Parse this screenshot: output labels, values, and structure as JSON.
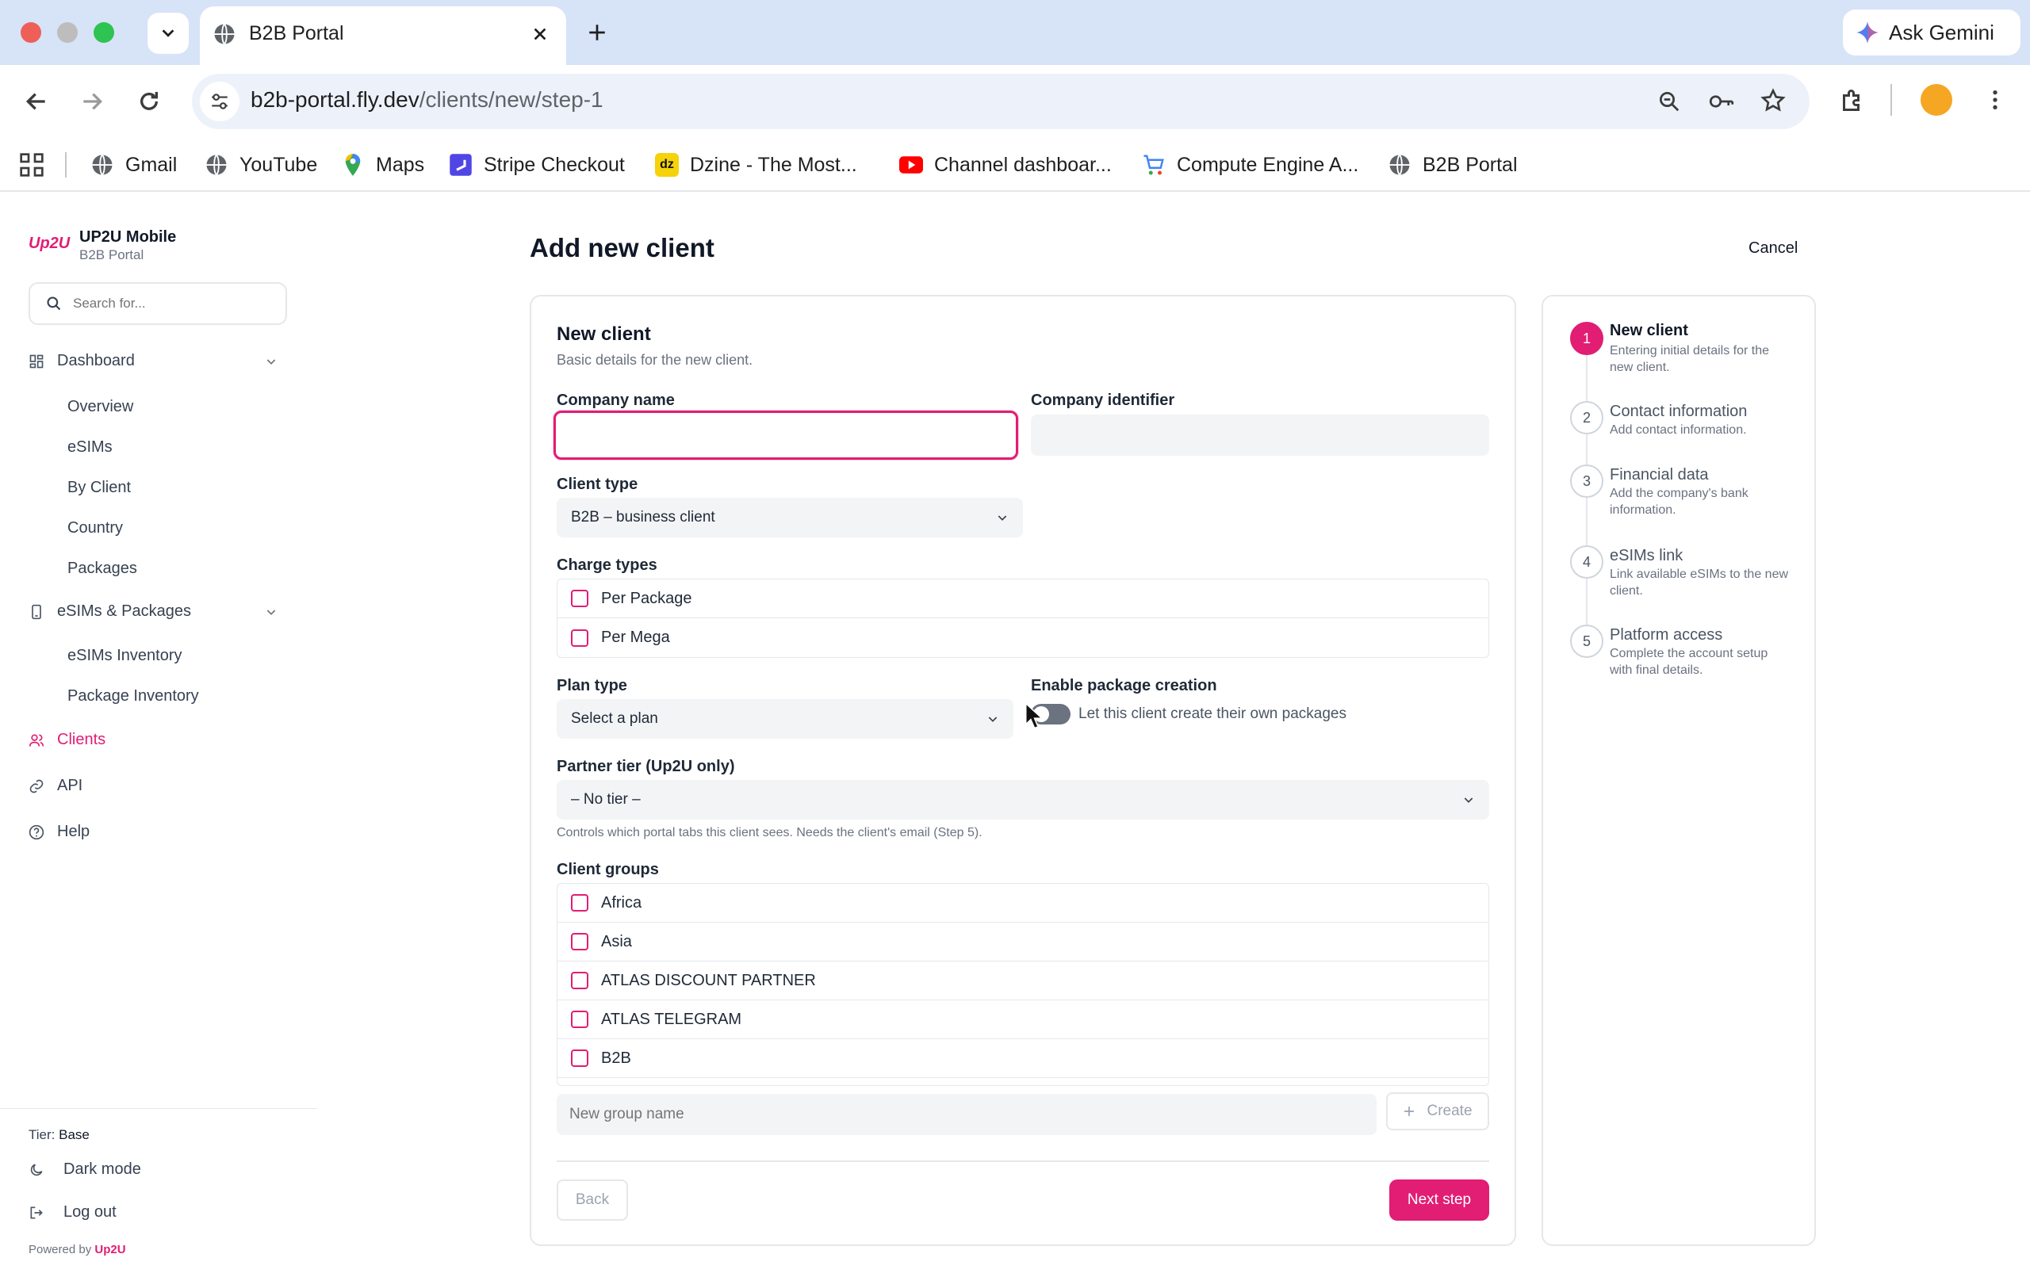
{
  "browser": {
    "tab_title": "B2B Portal",
    "url_host": "b2b-portal.fly.dev",
    "url_path": "/clients/new/step-1",
    "ask_gemini": "Ask Gemini",
    "bookmarks": [
      "Gmail",
      "YouTube",
      "Maps",
      "Stripe Checkout",
      "Dzine - The Most...",
      "Channel dashboar...",
      "Compute Engine A...",
      "B2B Portal"
    ],
    "dz_logo": "dz"
  },
  "brand": {
    "logo_text": "Up2U",
    "name": "UP2U Mobile",
    "subtitle": "B2B Portal"
  },
  "search": {
    "placeholder": "Search for..."
  },
  "nav": {
    "dashboard": "Dashboard",
    "dashboard_items": [
      "Overview",
      "eSIMs",
      "By Client",
      "Country",
      "Packages"
    ],
    "esims_packages": "eSIMs & Packages",
    "esims_items": [
      "eSIMs Inventory",
      "Package Inventory"
    ],
    "clients": "Clients",
    "api": "API",
    "help": "Help"
  },
  "footer": {
    "tier_label": "Tier:",
    "tier_value": "Base",
    "dark_mode": "Dark mode",
    "log_out": "Log out",
    "powered_by": "Powered by",
    "powered_brand": "Up2U"
  },
  "page": {
    "title": "Add new client",
    "cancel": "Cancel"
  },
  "form": {
    "section_title": "New client",
    "section_desc": "Basic details for the new client.",
    "company_name_label": "Company name",
    "company_identifier_label": "Company identifier",
    "client_type_label": "Client type",
    "client_type_value": "B2B – business client",
    "charge_types_label": "Charge types",
    "charge_types": [
      "Per Package",
      "Per Mega"
    ],
    "plan_type_label": "Plan type",
    "plan_type_value": "Select a plan",
    "enable_pkg_label": "Enable package creation",
    "enable_pkg_desc": "Let this client create their own packages",
    "partner_tier_label": "Partner tier (Up2U only)",
    "partner_tier_value": "– No tier –",
    "partner_tier_help": "Controls which portal tabs this client sees. Needs the client's email (Step 5).",
    "client_groups_label": "Client groups",
    "client_groups": [
      "Africa",
      "Asia",
      "ATLAS DISCOUNT PARTNER",
      "ATLAS TELEGRAM",
      "B2B"
    ],
    "new_group_placeholder": "New group name",
    "create": "Create",
    "back": "Back",
    "next": "Next step"
  },
  "steps": [
    {
      "num": "1",
      "title": "New client",
      "desc": "Entering initial details for the new client."
    },
    {
      "num": "2",
      "title": "Contact information",
      "desc": "Add contact information."
    },
    {
      "num": "3",
      "title": "Financial data",
      "desc": "Add the company's bank information."
    },
    {
      "num": "4",
      "title": "eSIMs link",
      "desc": "Link available eSIMs to the new client."
    },
    {
      "num": "5",
      "title": "Platform access",
      "desc": "Complete the account setup with final details."
    }
  ],
  "colors": {
    "accent": "#e11d74",
    "chrome": "#d7e3f7"
  }
}
